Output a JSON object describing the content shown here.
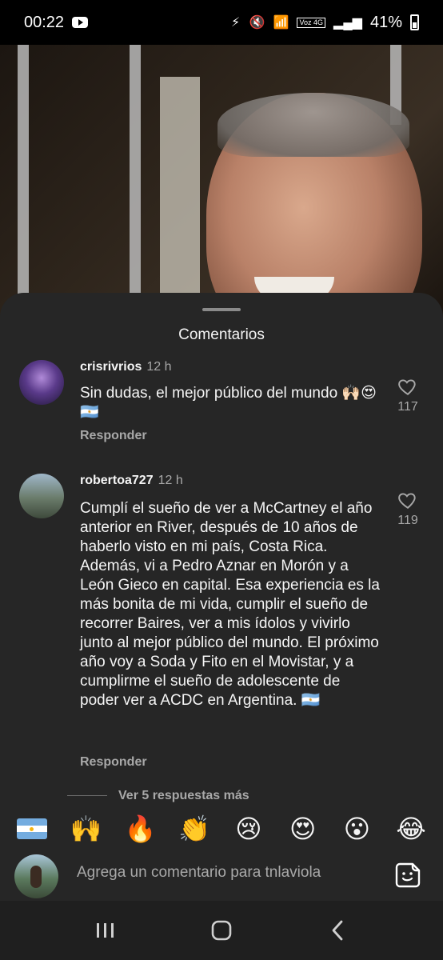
{
  "status_bar": {
    "time": "00:22",
    "network_label": "Voz 4G",
    "battery": "41%"
  },
  "sheet": {
    "title": "Comentarios"
  },
  "comments": [
    {
      "username": "crisrivrios",
      "time": "12 h",
      "text": "Sin dudas, el mejor público del mundo 🙌🏻😍🇦🇷",
      "reply_label": "Responder",
      "likes": "117"
    },
    {
      "username": "robertoa727",
      "time": "12 h",
      "text": "Cumplí el sueño de ver a McCartney el año anterior en River, después de 10 años de haberlo visto en mi país, Costa Rica. Además, vi a Pedro Aznar en Morón y a León Gieco en capital. Esa experiencia es la más bonita de mi vida, cumplir el sueño de recorrer Baires, ver a mis ídolos y vivirlo junto al mejor público del mundo. El próximo año voy a Soda y Fito en el Movistar, y a cumplirme el sueño de adolescente de poder ver a ACDC en Argentina. 🇦🇷",
      "reply_label": "Responder",
      "likes": "119",
      "more_replies": "Ver 5 respuestas más"
    }
  ],
  "emoji_bar": [
    "🙌",
    "🔥",
    "👏",
    "😢",
    "😍",
    "😮",
    "😂"
  ],
  "input": {
    "placeholder": "Agrega un comentario para tnlaviola"
  },
  "colors": {
    "sheet_bg": "#262626",
    "text_primary": "#f5f5f5",
    "text_secondary": "#a8a8a8"
  }
}
